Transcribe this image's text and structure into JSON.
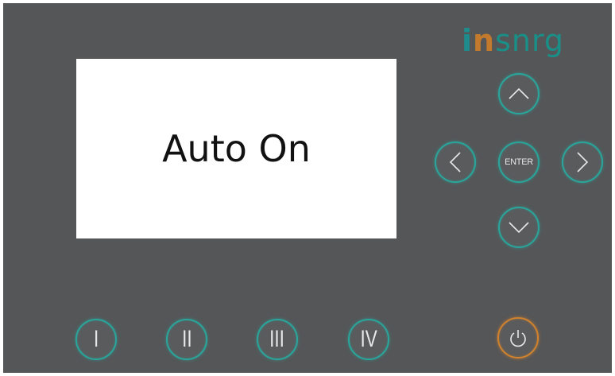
{
  "panel": {
    "logo": {
      "part1": "i",
      "part2": "n",
      "part3": "snrg"
    },
    "display": {
      "text": "Auto On"
    },
    "nav": {
      "up_icon": "chevron-up-icon",
      "down_icon": "chevron-down-icon",
      "left_icon": "chevron-left-icon",
      "right_icon": "chevron-right-icon",
      "enter_label": "ENTER"
    },
    "speed_buttons": [
      "I",
      "II",
      "III",
      "IV"
    ],
    "power_icon": "power-icon",
    "colors": {
      "panel": "#555658",
      "accent": "#2aa59b",
      "power": "#d0822e",
      "logo_teal": "#1e8c8c",
      "logo_orange": "#c47a2c"
    }
  }
}
